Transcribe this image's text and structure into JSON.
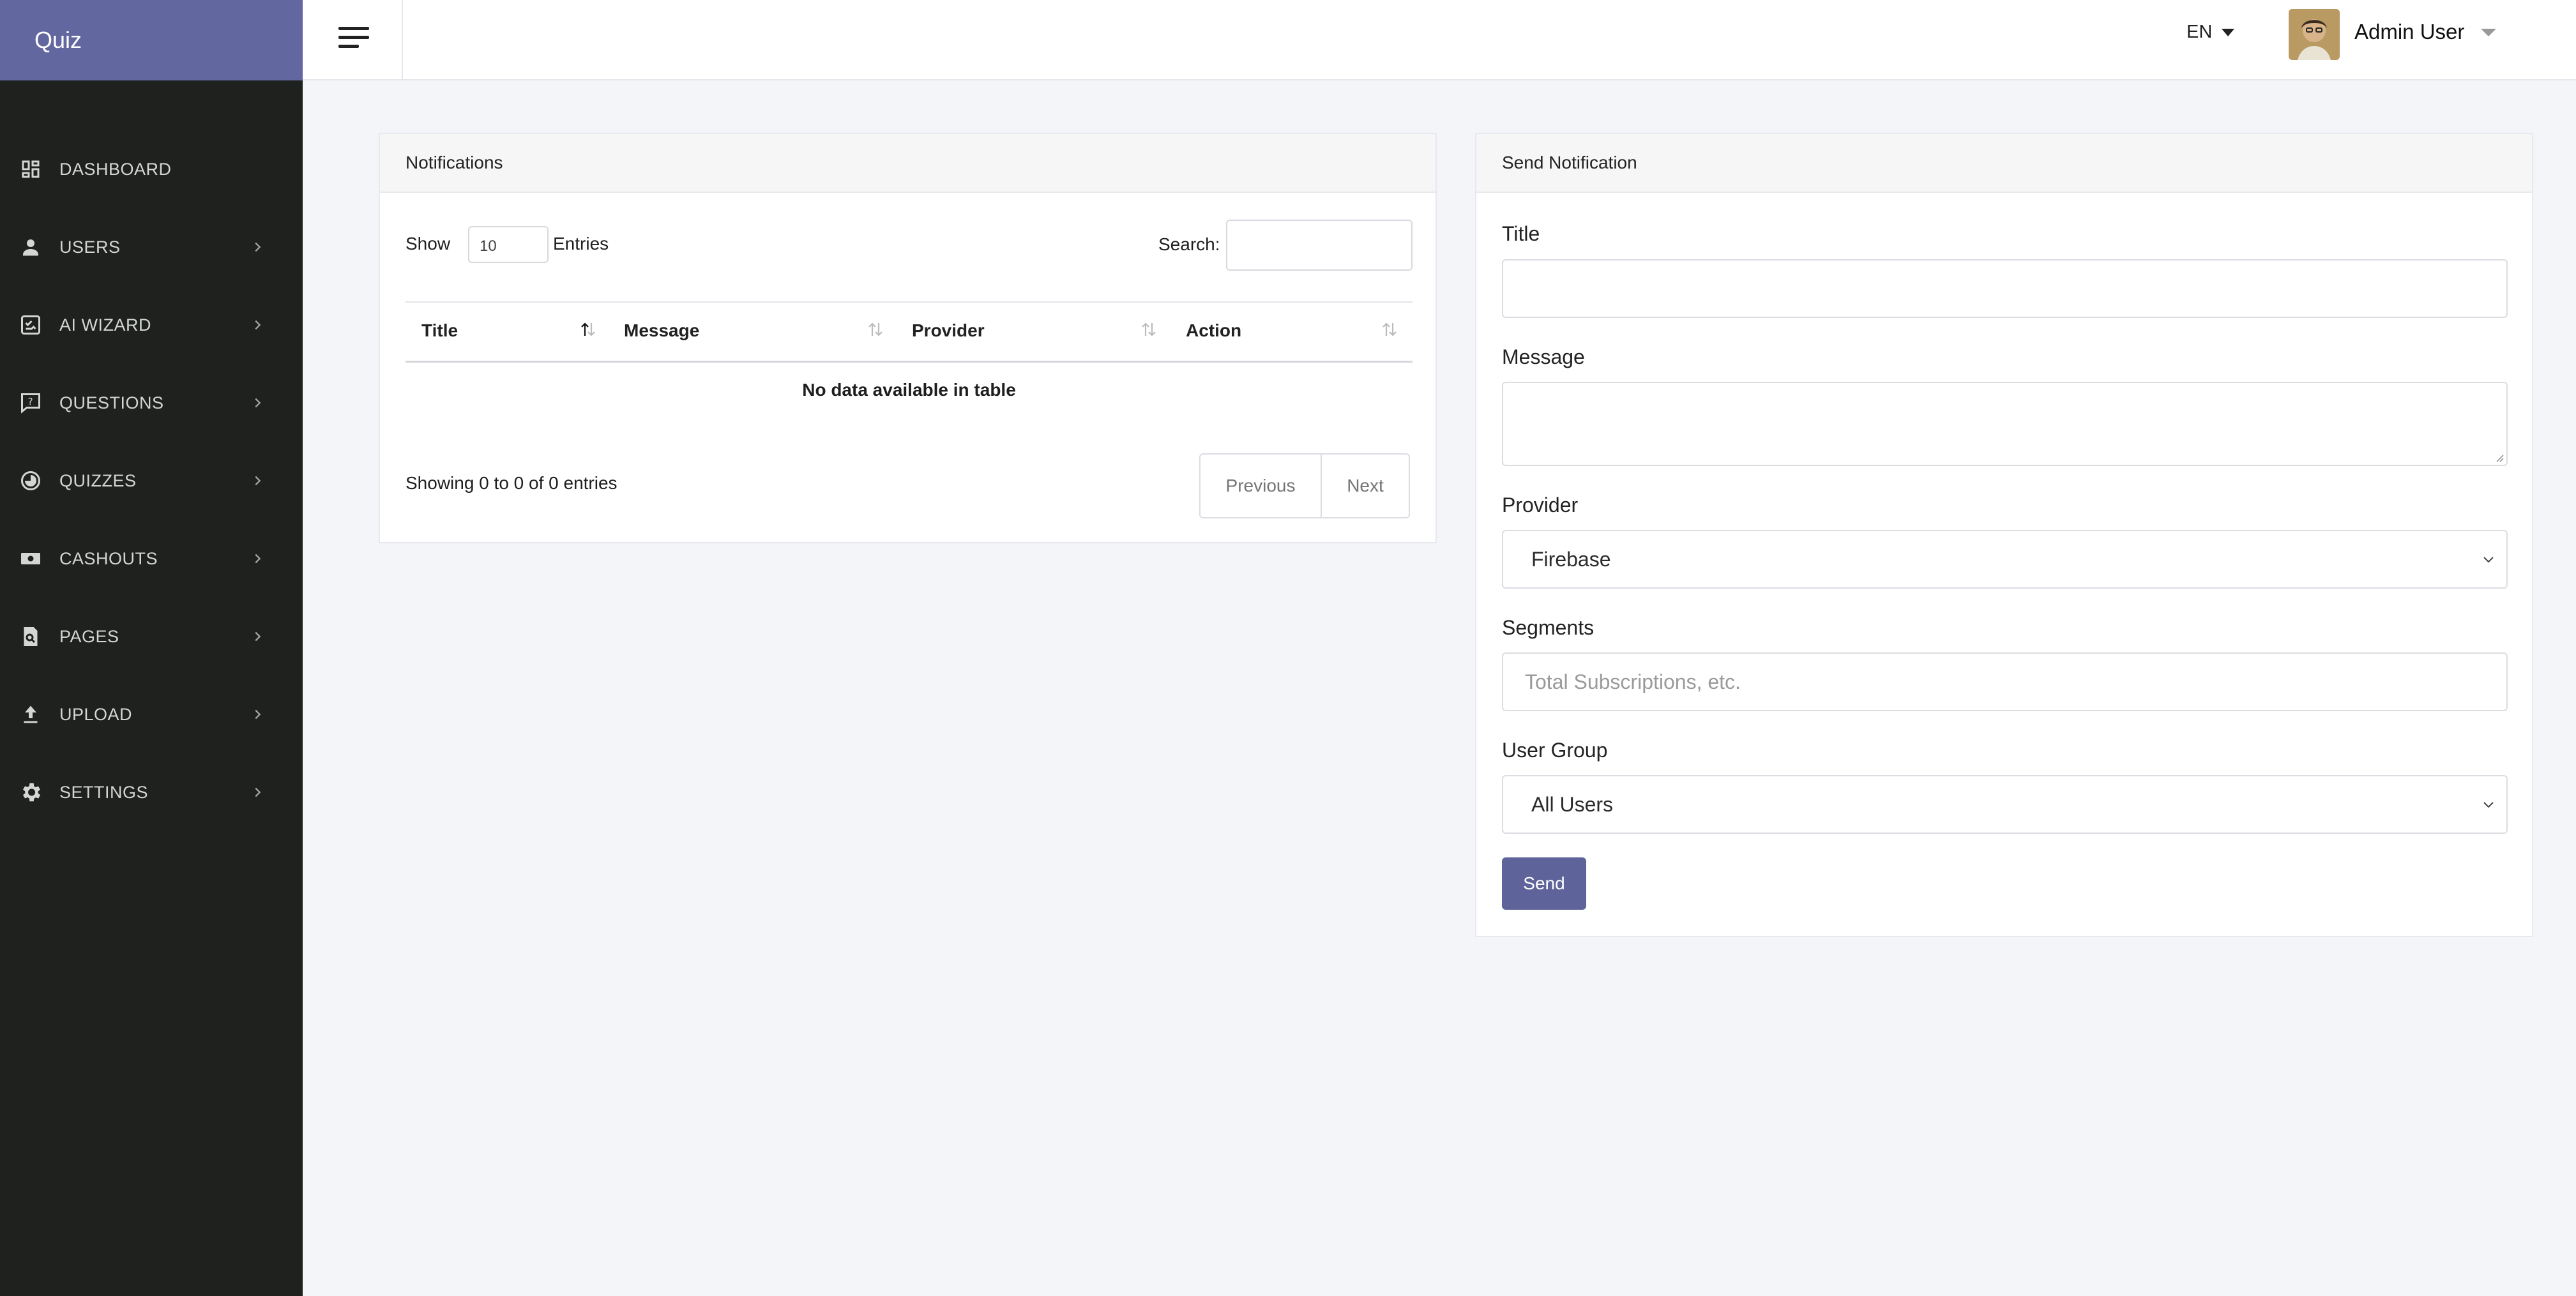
{
  "brand": {
    "title": "Quiz"
  },
  "sidebar": {
    "items": [
      {
        "label": "DASHBOARD",
        "icon": "dashboard-icon",
        "has_chevron": false
      },
      {
        "label": "USERS",
        "icon": "user-icon",
        "has_chevron": true
      },
      {
        "label": "AI WIZARD",
        "icon": "ai-wizard-icon",
        "has_chevron": true
      },
      {
        "label": "QUESTIONS",
        "icon": "question-icon",
        "has_chevron": true
      },
      {
        "label": "QUIZZES",
        "icon": "quiz-icon",
        "has_chevron": true
      },
      {
        "label": "CASHOUTS",
        "icon": "cash-icon",
        "has_chevron": true
      },
      {
        "label": "PAGES",
        "icon": "pages-icon",
        "has_chevron": true
      },
      {
        "label": "UPLOAD",
        "icon": "upload-icon",
        "has_chevron": true
      },
      {
        "label": "SETTINGS",
        "icon": "gear-icon",
        "has_chevron": true
      }
    ]
  },
  "topbar": {
    "language": "EN",
    "user_name": "Admin User"
  },
  "notifications": {
    "title": "Notifications",
    "show_label": "Show",
    "entries_value": "10",
    "entries_label": "Entries",
    "search_label": "Search:",
    "search_value": "",
    "columns": [
      "Title",
      "Message",
      "Provider",
      "Action"
    ],
    "empty_message": "No data available in table",
    "info": "Showing 0 to 0 of 0 entries",
    "prev_label": "Previous",
    "next_label": "Next"
  },
  "send_notification": {
    "title": "Send Notification",
    "title_label": "Title",
    "title_value": "",
    "message_label": "Message",
    "message_value": "",
    "provider_label": "Provider",
    "provider_value": "Firebase",
    "segments_label": "Segments",
    "segments_placeholder": "Total Subscriptions, etc.",
    "user_group_label": "User Group",
    "user_group_value": "All Users",
    "send_label": "Send"
  },
  "colors": {
    "brand_bg": "#6367a0",
    "sidebar_bg": "#1e211e",
    "button_bg": "#5e649a",
    "page_bg": "#f4f5f9"
  }
}
